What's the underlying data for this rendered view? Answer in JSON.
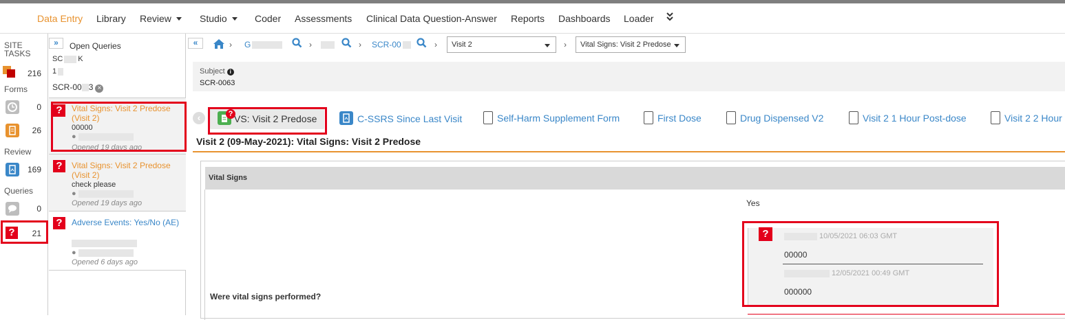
{
  "nav": {
    "items": [
      "Data Entry",
      "Library",
      "Review",
      "Studio",
      "Coder",
      "Assessments",
      "Clinical Data Question-Answer",
      "Reports",
      "Dashboards",
      "Loader"
    ],
    "more_icon": "double-chevron-down-icon"
  },
  "site_tasks": {
    "title": "SITE TASKS",
    "total": "216",
    "forms_label": "Forms",
    "forms_pending": "0",
    "forms_open": "26",
    "review_label": "Review",
    "review_count": "169",
    "queries_label": "Queries",
    "queries_comments": "0",
    "queries_open": "21"
  },
  "queries_panel": {
    "title": "Open Queries",
    "line1": "SC",
    "line1_suffix": "K",
    "line2": "1",
    "subject": "SCR-00",
    "subject_suffix": "3",
    "items": [
      {
        "title": "Vital Signs: Visit 2 Predose (Visit 2)",
        "text": "00000",
        "opened": "Opened 19 days ago"
      },
      {
        "title": "Vital Signs: Visit 2 Predose (Visit 2)",
        "text": "check please",
        "opened": "Opened 19 days ago"
      },
      {
        "title": "Adverse Events: Yes/No (AE)",
        "text": "",
        "opened": "Opened 6 days ago"
      }
    ]
  },
  "breadcrumb": {
    "crumb1": "G",
    "crumb3": "SCR-00",
    "visit_select": "Visit 2",
    "form_select": "Vital Signs: Visit 2 Predose"
  },
  "subject": {
    "label": "Subject",
    "value": "SCR-0063"
  },
  "form_tabs": [
    "VS: Visit 2 Predose",
    "C-SSRS Since Last Visit",
    "Self-Harm Supplement Form",
    "First Dose",
    "Drug Dispensed V2",
    "Visit 2 1 Hour Post-dose",
    "Visit 2 2 Hour"
  ],
  "form": {
    "heading": "Visit 2 (09-May-2021): Vital Signs: Visit 2 Predose",
    "section_title": "Vital Signs",
    "question": "Were vital signs performed?",
    "answer": "Yes",
    "query_history": [
      {
        "timestamp": "10/05/2021 06:03 GMT",
        "text": "00000"
      },
      {
        "timestamp": "12/05/2021 00:49 GMT",
        "text": "000000"
      }
    ]
  },
  "colors": {
    "accent": "#e8922e",
    "link": "#3a87c8",
    "query_red": "#e3001b"
  }
}
